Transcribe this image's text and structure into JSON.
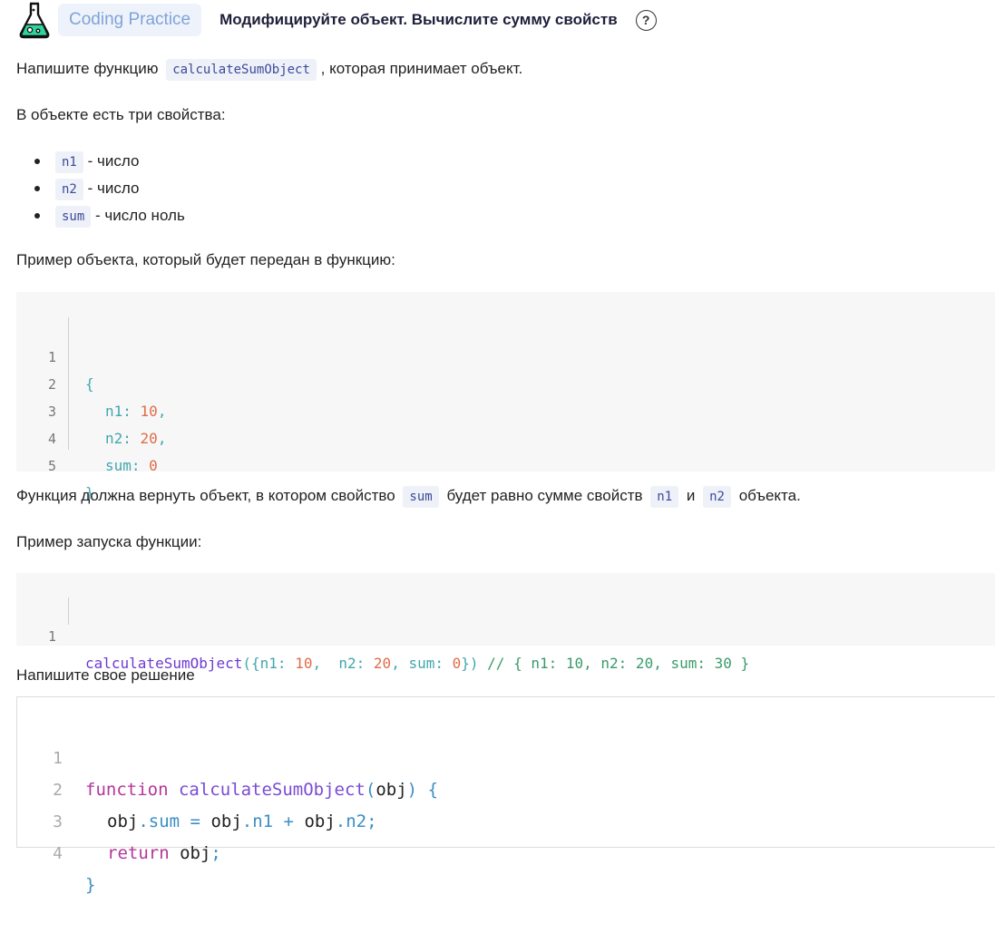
{
  "header": {
    "badge": "Coding Practice",
    "title": "Модифицируйте объект. Вычислите сумму свойств",
    "help": "?"
  },
  "intro": {
    "pre": "Напишите функцию",
    "fn": "calculateSumObject",
    "post": ", которая принимает объект."
  },
  "props_heading": "В объекте есть три свойства:",
  "props": [
    {
      "code": "n1",
      "desc": "- число"
    },
    {
      "code": "n2",
      "desc": "- число"
    },
    {
      "code": "sum",
      "desc": "- число ноль"
    }
  ],
  "example_heading": "Пример объекта, который будет передан в функцию:",
  "example_code": {
    "line_numbers": [
      "1",
      "2",
      "3",
      "4",
      "5"
    ],
    "open": "{",
    "rows": [
      {
        "key": "n1:",
        "val": "10",
        "comma": ","
      },
      {
        "key": "n2:",
        "val": "20",
        "comma": ","
      },
      {
        "key": "sum:",
        "val": "0",
        "comma": ""
      }
    ],
    "close": "}"
  },
  "result_text": {
    "pre": "Функция должна вернуть объект, в котором свойство",
    "c1": "sum",
    "mid": "будет равно сумме свойств",
    "c2": "n1",
    "and": "и",
    "c3": "n2",
    "post": "объекта."
  },
  "run_heading": "Пример запуска функции:",
  "run_code": {
    "line_number": "1",
    "fn": "calculateSumObject",
    "p1": "({",
    "k1": "n1:",
    "v1": "10",
    "s1": ",  ",
    "k2": "n2:",
    "v2": "20",
    "s2": ", ",
    "k3": "sum:",
    "v3": "0",
    "p2": "})",
    "comment": "// { n1: 10, n2: 20, sum: 30 }"
  },
  "solution_heading": "Напишите свое решение",
  "editor": {
    "line_numbers": [
      "1",
      "2",
      "3",
      "4"
    ],
    "l1_kw": "function",
    "l1_fn": "calculateSumObject",
    "l1_open": "(",
    "l1_arg": "obj",
    "l1_close": ")",
    "l1_brace": "{",
    "l2_a": "obj",
    "l2_dot1": ".",
    "l2_sum": "sum",
    "l2_eq": " = ",
    "l2_b": "obj",
    "l2_dot2": ".",
    "l2_n1": "n1",
    "l2_plus": " + ",
    "l2_c": "obj",
    "l2_dot3": ".",
    "l2_n2": "n2",
    "l2_semi": ";",
    "l3_kw": "return",
    "l3_obj": "obj",
    "l3_semi": ";",
    "l4_brace": "}"
  }
}
